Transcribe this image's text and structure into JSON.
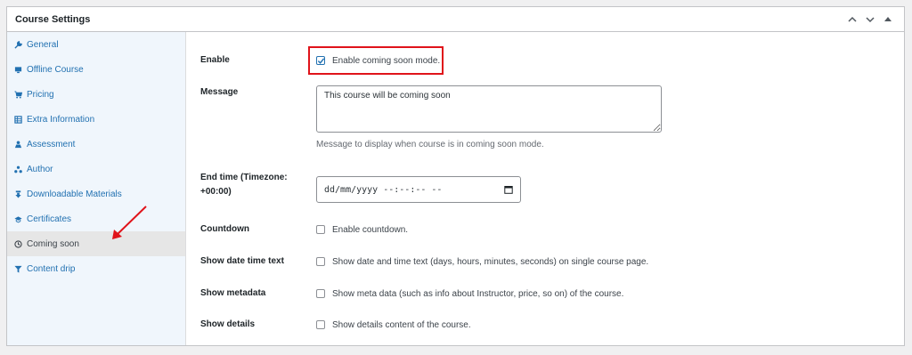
{
  "panel": {
    "title": "Course Settings"
  },
  "sidebar": {
    "items": [
      {
        "label": "General",
        "icon": "wrench-icon"
      },
      {
        "label": "Offline Course",
        "icon": "monitor-icon"
      },
      {
        "label": "Pricing",
        "icon": "cart-icon"
      },
      {
        "label": "Extra Information",
        "icon": "info-table-icon"
      },
      {
        "label": "Assessment",
        "icon": "assessment-icon"
      },
      {
        "label": "Author",
        "icon": "author-icon"
      },
      {
        "label": "Downloadable Materials",
        "icon": "download-icon"
      },
      {
        "label": "Certificates",
        "icon": "certificate-icon"
      },
      {
        "label": "Coming soon",
        "icon": "clock-icon",
        "active": true
      },
      {
        "label": "Content drip",
        "icon": "funnel-icon"
      }
    ]
  },
  "form": {
    "enable": {
      "label": "Enable",
      "text": "Enable coming soon mode.",
      "checked": true
    },
    "message": {
      "label": "Message",
      "value": "This course will be coming soon",
      "description": "Message to display when course is in coming soon mode."
    },
    "end_time": {
      "label_line1": "End time (Timezone:",
      "label_line2": "+00:00)",
      "placeholder": "dd/mm/yyyy --:--:-- --"
    },
    "countdown": {
      "label": "Countdown",
      "text": "Enable countdown."
    },
    "show_date_time": {
      "label": "Show date time text",
      "text": "Show date and time text (days, hours, minutes, seconds) on single course page."
    },
    "show_metadata": {
      "label": "Show metadata",
      "text": "Show meta data (such as info about Instructor, price, so on) of the course."
    },
    "show_details": {
      "label": "Show details",
      "text": "Show details content of the course."
    }
  },
  "colors": {
    "accent": "#2271b1",
    "highlight": "#e0131a"
  }
}
